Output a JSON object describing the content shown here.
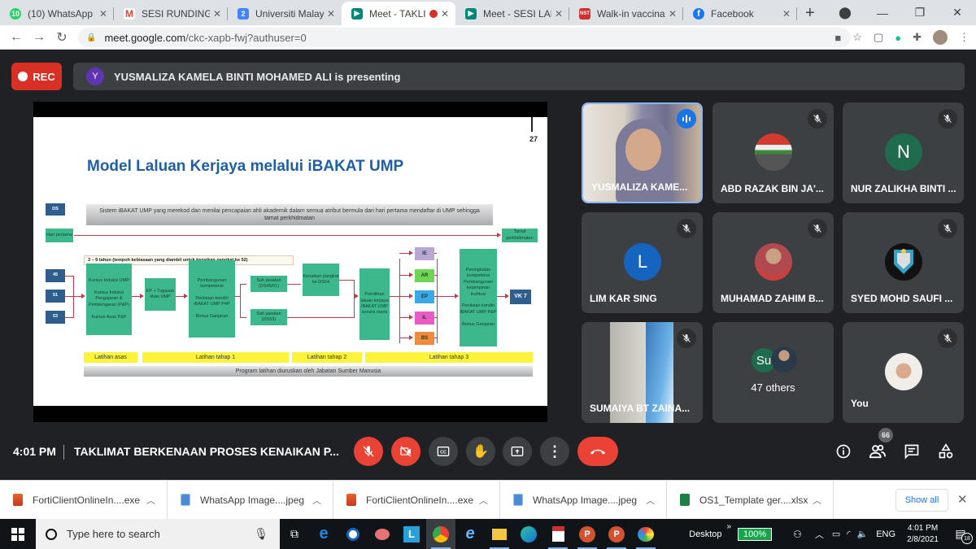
{
  "browser": {
    "tabs": [
      {
        "title": "(10) WhatsApp",
        "icon": "whatsapp-icon",
        "color": "#25d366",
        "glyph": "10",
        "active": false
      },
      {
        "title": "SESI RUNDINGAN",
        "icon": "gmail-icon",
        "color": "#ea4335",
        "glyph": "M",
        "active": false
      },
      {
        "title": "Universiti Malaysia",
        "icon": "calendar-icon",
        "color": "#4285f4",
        "glyph": "2",
        "active": false
      },
      {
        "title": "Meet - TAKLIMAT",
        "icon": "meet-icon",
        "color": "#00897b",
        "glyph": "▶",
        "active": true,
        "recording": true
      },
      {
        "title": "Meet - SESI LAPOR",
        "icon": "meet-icon",
        "color": "#00897b",
        "glyph": "▶",
        "active": false
      },
      {
        "title": "Walk-in vaccination",
        "icon": "nst-icon",
        "color": "#d32f2f",
        "glyph": "NST",
        "active": false
      },
      {
        "title": "Facebook",
        "icon": "facebook-icon",
        "color": "#1877f2",
        "glyph": "f",
        "active": false
      }
    ],
    "new_tab": "+",
    "url_host": "meet.google.com",
    "url_path": "/ckc-xapb-fwj?authuser=0"
  },
  "meet": {
    "rec_label": "REC",
    "presenter_initial": "Y",
    "presenting_text": "YUSMALIZA KAMELA BINTI MOHAMED ALI is presenting",
    "slide": {
      "page": "27",
      "title": "Model Laluan Kerjaya melalui iBAKAT UMP",
      "ds": "DS",
      "system_text": "Sistem iBAKAT UMP yang merekod dan menilai pencapaian ahli akademik dalam semua atribut bermula dari hari pertama mendaftar di UMP sehingga tamat perkhidmatan",
      "hari_pertama": "Hari pertama",
      "tamat": "Tamat perkhidmatan",
      "years": "3 – 9 tahun (tempoh kebiasaan yang diambil untuk kenaikan pangkat ke 52)",
      "grades": [
        "45",
        "51",
        "53"
      ],
      "kursus": "Kursus Induksi UMP\n\nKursus Induksi Pengajaran & Pembelajaran (P&P)\n\nKursus Asas P&P",
      "ep": "EP + Tugasan khas UMP",
      "pembangunan": "Pembangunan kompetensi\n\nPenilaian kendiri iBAKAT UMP P4P\n\nBonus Ganjaran",
      "sah1": "Sah jawatan (DS45/51)",
      "sah2": "Sah jawatan (DS53)",
      "kenaikan": "Kenaikan pangkat ke DS54",
      "pemilihan": "Pemilihan laluan kerjaya iBAKAT UMP secara rasmi",
      "paths": [
        {
          "label": "IE",
          "color": "#b7a6d6"
        },
        {
          "label": "AR",
          "color": "#6fd653"
        },
        {
          "label": "EP",
          "color": "#3ba9e8"
        },
        {
          "label": "IL",
          "color": "#e85bc7"
        },
        {
          "label": "BS",
          "color": "#f08a3c"
        }
      ],
      "peningkatan": "Peningkatan kompetensi Pembangunan kepimpinan institusi\n\nPenilaian kendiri iBAKAT UMP P&P\n\nBonus Ganjaran",
      "vk7": "VK 7",
      "stages": [
        "Latihan asas",
        "Latihan tahap 1",
        "Latihan tahap 2",
        "Latihan tahap 3"
      ],
      "program": "Program latihan diuruskan oleh Jabatan Sumber Manusia"
    },
    "participants": [
      {
        "name": "YUSMALIZA KAME...",
        "type": "video",
        "speaking": true
      },
      {
        "name": "ABD RAZAK BIN JA'...",
        "type": "photo",
        "avatar_color": "#7a8a7a",
        "muted": true
      },
      {
        "name": "NUR ZALIKHA BINTI ...",
        "type": "initial",
        "initial": "N",
        "avatar_color": "#1e6b4e",
        "muted": true
      },
      {
        "name": "LIM KAR SING",
        "type": "initial",
        "initial": "L",
        "avatar_color": "#1565c0",
        "muted": true
      },
      {
        "name": "MUHAMAD ZAHIM B...",
        "type": "photo",
        "avatar_color": "#a0524d",
        "muted": true
      },
      {
        "name": "SYED MOHD SAUFI ...",
        "type": "photo",
        "avatar_color": "#111111",
        "muted": true
      },
      {
        "name": "SUMAIYA BT ZAINA...",
        "type": "video2",
        "muted": true
      },
      {
        "name": "47 others",
        "type": "others",
        "initial": "Su"
      },
      {
        "name": "You",
        "type": "photo",
        "avatar_color": "#e9e4df",
        "muted": true
      }
    ],
    "time": "4:01 PM",
    "meeting_name": "TAKLIMAT BERKENAAN PROSES KENAIKAN P...",
    "participant_count": "66"
  },
  "downloads": {
    "items": [
      {
        "name": "FortiClientOnlineIn....exe",
        "type": "exe"
      },
      {
        "name": "WhatsApp Image....jpeg",
        "type": "jpeg"
      },
      {
        "name": "FortiClientOnlineIn....exe",
        "type": "exe"
      },
      {
        "name": "WhatsApp Image....jpeg",
        "type": "jpeg"
      },
      {
        "name": "OS1_Template ger....xlsx",
        "type": "xlsx"
      }
    ],
    "show_all": "Show all"
  },
  "taskbar": {
    "search_placeholder": "Type here to search",
    "desktop_label": "Desktop",
    "battery": "100%",
    "lang": "ENG",
    "time": "4:01 PM",
    "date": "2/8/2021",
    "notifications": "18"
  }
}
